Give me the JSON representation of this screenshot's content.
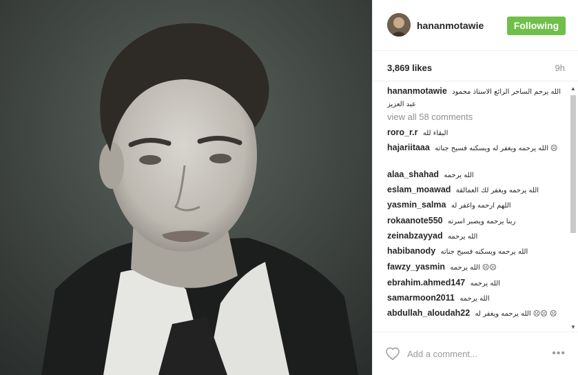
{
  "header": {
    "username": "hananmotawie",
    "follow_label": "Following"
  },
  "stats": {
    "likes": "3,869 likes",
    "time": "9h"
  },
  "caption": {
    "user": "hananmotawie",
    "text": "الله يرحم الساحر الرائع الاستاذ محمود عبد العزيز"
  },
  "view_all": "view all 58 comments",
  "comments": [
    {
      "user": "roro_r.r",
      "text": "البقاء لله"
    },
    {
      "user": "hajariitaaa",
      "text": "الله يرحمه ويغفر له ويسكنه فسيح جناته ☹"
    },
    {
      "user": "alaa_shahad",
      "text": "الله يرحمه"
    },
    {
      "user": "eslam_moawad",
      "text": "الله يرحمه ويغفر لك العمالقة"
    },
    {
      "user": "yasmin_salma",
      "text": "اللهم ارحمه واغفر له"
    },
    {
      "user": "rokaanote550",
      "text": "ربنا يرحمه ويصبر اسرته"
    },
    {
      "user": "zeinabzayyad",
      "text": "الله يرحمه"
    },
    {
      "user": "habibanody",
      "text": "الله يرحمه ويسكنه فسيح جناته"
    },
    {
      "user": "fawzy_yasmin",
      "text": "الله يرحمه ☹☹"
    },
    {
      "user": "ebrahim.ahmed147",
      "text": "الله يرحمه"
    },
    {
      "user": "samarmoon2011",
      "text": "الله يرحمه"
    },
    {
      "user": "abdullah_aloudah22",
      "text": "الله يرحمه ويغفر له ☹☹ ☹"
    }
  ],
  "add_comment": {
    "placeholder": "Add a comment..."
  },
  "colors": {
    "follow": "#6fbf4a",
    "muted": "#8e8e8e"
  }
}
